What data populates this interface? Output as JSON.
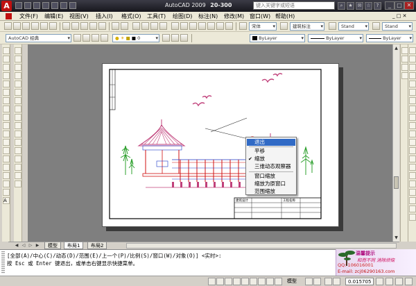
{
  "titlebar": {
    "app_title": "AutoCAD 2009",
    "file_name": "20-300",
    "search_placeholder": "键入关键字或短语",
    "logo_letter": "A",
    "window_buttons": [
      "_",
      "□",
      "✕"
    ]
  },
  "menubar": {
    "items": [
      "文件(F)",
      "编辑(E)",
      "视图(V)",
      "插入(I)",
      "格式(O)",
      "工具(T)",
      "绘图(D)",
      "标注(N)",
      "修改(M)",
      "窗口(W)",
      "帮助(H)"
    ]
  },
  "toolbar": {
    "workspace": "AutoCAD 经典",
    "text_style": "宋体",
    "dim_style": "建筑标注",
    "table_style": "Stand",
    "layer": "0",
    "color": "ByLayer",
    "linetype": "ByLayer",
    "lineweight": "ByLayer"
  },
  "tabs": {
    "items": [
      "模型",
      "布局1",
      "布局2"
    ],
    "active": "布局1"
  },
  "context_menu": {
    "items": [
      {
        "label": "退出",
        "highlighted": true,
        "checked": false
      },
      {
        "label": "平移",
        "highlighted": false,
        "checked": false
      },
      {
        "label": "缩放",
        "highlighted": false,
        "checked": true
      },
      {
        "label": "三维动态观察器",
        "highlighted": false,
        "checked": false
      },
      {
        "label": "窗口缩放",
        "highlighted": false,
        "checked": false
      },
      {
        "label": "缩放为原窗口",
        "highlighted": false,
        "checked": false
      },
      {
        "label": "范围缩放",
        "highlighted": false,
        "checked": false
      }
    ]
  },
  "command": {
    "line1": "[全部(A)/中心(C)/动态(D)/范围(E)/上一个(P)/比例(S)/窗口(W)/对象(O)] <实时>:",
    "line2": "按 Esc 或 Enter 键退出，或单击右键显示快捷菜单。"
  },
  "watermark": {
    "title": "温馨提示",
    "slogan": "和而不同 消除烦恼",
    "qq": "QQ: 106016001",
    "email": "E-mail: zcj06290163.com"
  },
  "statusbar": {
    "mode": "模型",
    "scale": "0.015705"
  },
  "title_block": {
    "label_a": "建筑设计",
    "label_b": "工程名称"
  },
  "colors": {
    "titlebar_dark": "#17171d",
    "menu_highlight": "#316ac5",
    "drawing_bg": "#7f7f7f",
    "roof_magenta": "#c0407a",
    "tree_green": "#2ea02e",
    "structure_red": "#d01010",
    "structure_blue": "#1a38c8"
  }
}
